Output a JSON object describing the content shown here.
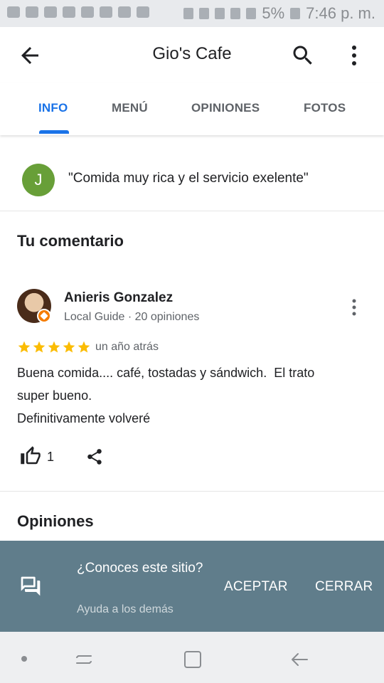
{
  "status_bar": {
    "battery": "5%",
    "time": "7:46 p. m."
  },
  "app_bar": {
    "title": "Gio's Cafe"
  },
  "tabs": [
    {
      "label": "INFO",
      "active": true
    },
    {
      "label": "MENÚ",
      "active": false
    },
    {
      "label": "OPINIONES",
      "active": false
    },
    {
      "label": "FOTOS",
      "active": false
    }
  ],
  "highlight_quote": {
    "avatar_letter": "J",
    "text": "\"Comida muy rica y el servicio exelente\""
  },
  "your_comment": {
    "section_title": "Tu comentario",
    "reviewer_name": "Anieris Gonzalez",
    "reviewer_meta": "Local Guide · 20 opiniones",
    "rating": 5,
    "time": "un año atrás",
    "body_lines": [
      "Buena comida.... café, tostadas y sándwich.  El trato",
      "super bueno.",
      "Definitivamente volveré"
    ],
    "likes": "1"
  },
  "reviews_section": {
    "title": "Opiniones"
  },
  "banner": {
    "question": "¿Conoces este sitio?",
    "help": "Ayuda a los demás",
    "accept_label": "ACEPTAR",
    "close_label": "CERRAR"
  },
  "colors": {
    "accent": "#1a73e8",
    "star": "#fbbc04",
    "banner_bg": "#607d8b",
    "avatar_j": "#689f38"
  }
}
